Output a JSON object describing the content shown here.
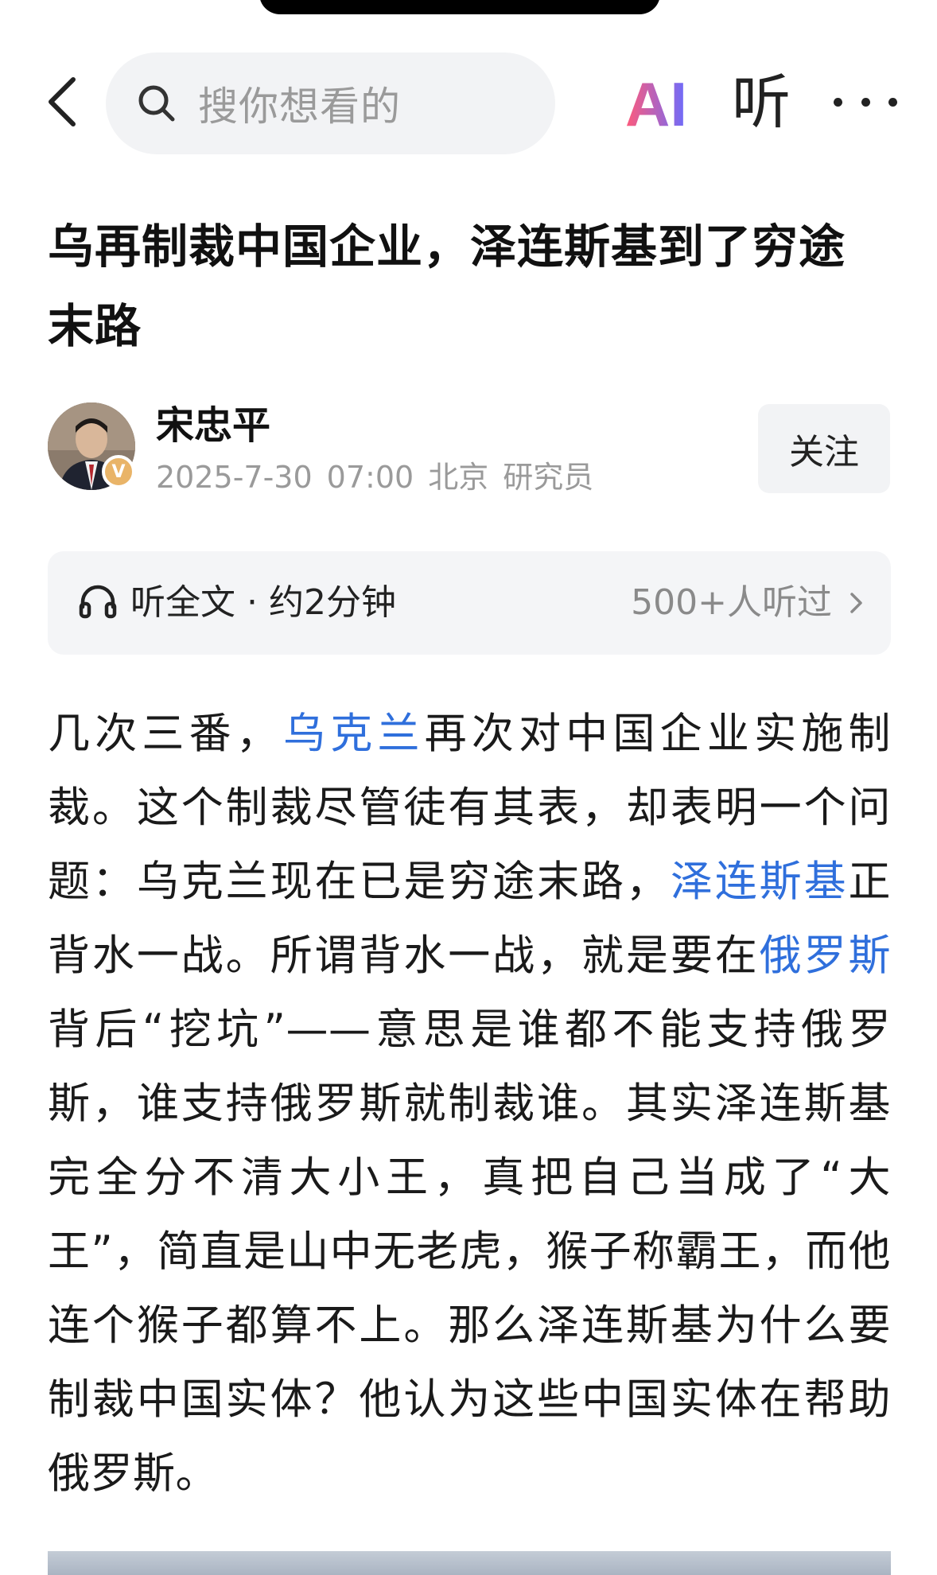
{
  "topbar": {
    "search_placeholder": "搜你想看的",
    "ai_label": "AI",
    "listen_label": "听"
  },
  "article": {
    "title": "乌再制裁中国企业，泽连斯基到了穷途末路",
    "author": {
      "name": "宋忠平",
      "badge": "V",
      "date": "2025-7-30",
      "time": "07:00",
      "location": "北京",
      "role": "研究员"
    },
    "follow_label": "关注",
    "listen_card": {
      "label": "听全文 · 约2分钟",
      "count": "500+人听过"
    },
    "body": {
      "p1_a": "几次三番，",
      "link1": "乌克兰",
      "p1_b": "再次对中国企业实施制裁。这个制裁尽管徒有其表，却表明一个问题：乌克兰现在已是穷途末路，",
      "link2": "泽连斯基",
      "p1_c": "正背水一战。所谓背水一战，就是要在",
      "link3": "俄罗斯",
      "p1_d": "背后“挖坑”——意思是谁都不能支持俄罗斯，谁支持俄罗斯就制裁谁。其实泽连斯基完全分不清大小王，真把自己当成了“大王”，简直是山中无老虎，猴子称霸王，而他连个猴子都算不上。那么泽连斯基为什么要制裁中国实体？他认为这些中国实体在帮助俄罗斯。"
    }
  },
  "colors": {
    "link": "#2f6fdc",
    "ai_gradient_start": "#ff5a7a",
    "ai_gradient_end": "#6a6cff"
  }
}
